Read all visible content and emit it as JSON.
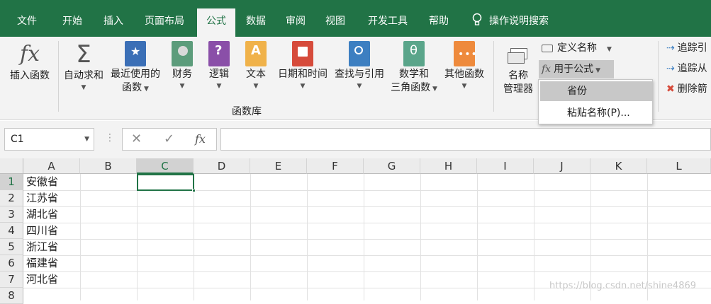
{
  "tabs": [
    "文件",
    "开始",
    "插入",
    "页面布局",
    "公式",
    "数据",
    "审阅",
    "视图",
    "开发工具",
    "帮助"
  ],
  "active_tab": "公式",
  "tell_me": "操作说明搜索",
  "ribbon": {
    "insert_function": "插入函数",
    "autosum": "自动求和",
    "recently_used_1": "最近使用的",
    "recently_used_2": "函数",
    "financial": "财务",
    "logical": "逻辑",
    "text": "文本",
    "datetime": "日期和时间",
    "lookup": "查找与引用",
    "math_1": "数学和",
    "math_2": "三角函数",
    "more": "其他函数",
    "group_label": "函数库",
    "name_manager_1": "名称",
    "name_manager_2": "管理器",
    "define_name": "定义名称",
    "use_in_formula": "用于公式",
    "trace_precedents": "追踪引",
    "trace_dependents": "追踪从",
    "remove_arrows": "删除箭"
  },
  "dropdown": {
    "item_selected": "省份",
    "paste_names": "粘贴名称(P)..."
  },
  "formula_bar": {
    "name_box": "C1",
    "fx": "fx",
    "content": ""
  },
  "columns": [
    "A",
    "B",
    "C",
    "D",
    "E",
    "F",
    "G",
    "H",
    "I",
    "J",
    "K",
    "L"
  ],
  "rows": [
    "1",
    "2",
    "3",
    "4",
    "5",
    "6",
    "7",
    "8"
  ],
  "col_a_values": [
    "安徽省",
    "江苏省",
    "湖北省",
    "四川省",
    "浙江省",
    "福建省",
    "河北省",
    ""
  ],
  "colors": {
    "excel_green": "#217346",
    "ribbon_bg": "#f3f3f3"
  },
  "watermark": "https://blog.csdn.net/shine4869"
}
